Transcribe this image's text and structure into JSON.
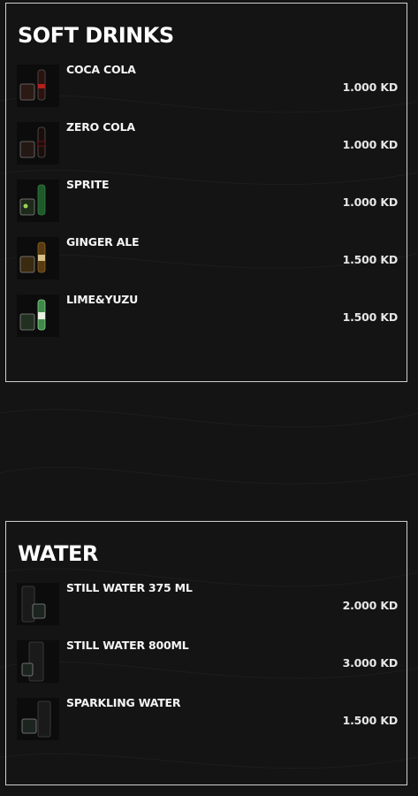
{
  "sections": [
    {
      "title": "SOFT DRINKS",
      "items": [
        {
          "name": "COCA COLA",
          "price": "1.000 KD",
          "icon": "drink-photo-cola"
        },
        {
          "name": "ZERO COLA",
          "price": "1.000 KD",
          "icon": "drink-photo-zero-cola"
        },
        {
          "name": "SPRITE",
          "price": "1.000 KD",
          "icon": "drink-photo-sprite"
        },
        {
          "name": "GINGER ALE",
          "price": "1.500 KD",
          "icon": "drink-photo-ginger-ale"
        },
        {
          "name": "LIME&YUZU",
          "price": "1.500 KD",
          "icon": "drink-photo-lime-yuzu"
        }
      ]
    },
    {
      "title": "WATER",
      "items": [
        {
          "name": "STILL WATER 375 ML",
          "price": "2.000 KD",
          "icon": "drink-photo-still-water-375"
        },
        {
          "name": "STILL WATER 800ML",
          "price": "3.000 KD",
          "icon": "drink-photo-still-water-800"
        },
        {
          "name": "SPARKLING WATER",
          "price": "1.500 KD",
          "icon": "drink-photo-sparkling-water"
        }
      ]
    }
  ],
  "colors": {
    "background": "#141414",
    "border": "#cfcfcf",
    "text": "#f2f2f2"
  }
}
